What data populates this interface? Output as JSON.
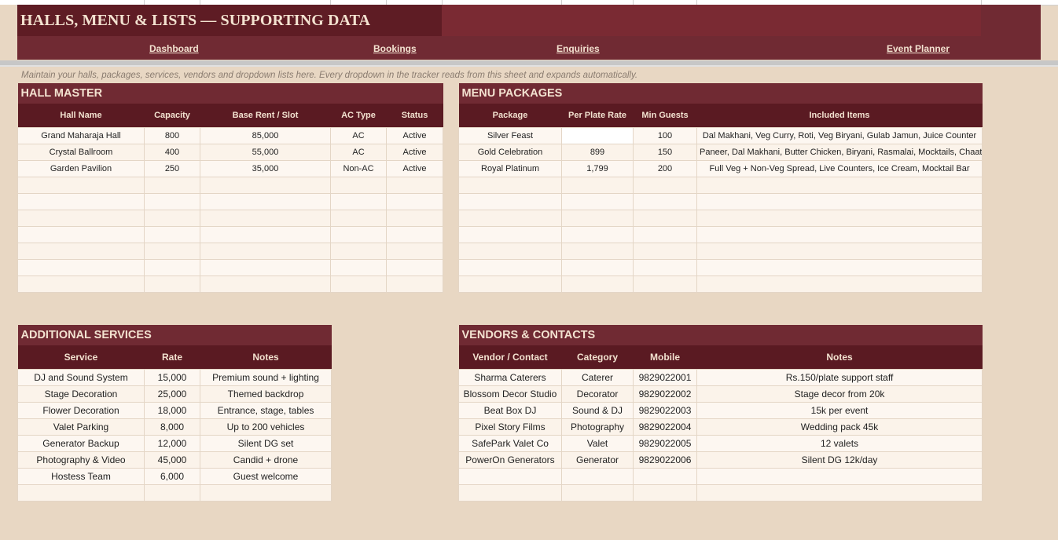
{
  "header": {
    "title": "HALLS, MENU & LISTS — SUPPORTING DATA",
    "nav": [
      "Dashboard",
      "Bookings",
      "Enquiries",
      "Event Planner"
    ]
  },
  "hint": "Maintain your halls, packages, services, vendors and dropdown lists here. Every dropdown in the tracker reads from this sheet and expands automatically.",
  "hall_master": {
    "title": "HALL MASTER",
    "columns": [
      "Hall Name",
      "Capacity",
      "Base Rent / Slot",
      "AC Type",
      "Status"
    ],
    "rows": [
      [
        "Grand Maharaja Hall",
        "800",
        "85,000",
        "AC",
        "Active"
      ],
      [
        "Crystal Ballroom",
        "400",
        "55,000",
        "AC",
        "Active"
      ],
      [
        "Garden Pavilion",
        "250",
        "35,000",
        "Non-AC",
        "Active"
      ],
      [
        "",
        "",
        "",
        "",
        ""
      ],
      [
        "",
        "",
        "",
        "",
        ""
      ],
      [
        "",
        "",
        "",
        "",
        ""
      ],
      [
        "",
        "",
        "",
        "",
        ""
      ],
      [
        "",
        "",
        "",
        "",
        ""
      ],
      [
        "",
        "",
        "",
        "",
        ""
      ],
      [
        "",
        "",
        "",
        "",
        ""
      ]
    ]
  },
  "menu_packages": {
    "title": "MENU PACKAGES",
    "columns": [
      "Package",
      "Per Plate Rate",
      "Min Guests",
      "Included Items"
    ],
    "rows": [
      [
        "Silver Feast",
        "",
        "100",
        "Dal Makhani, Veg Curry, Roti, Veg Biryani, Gulab Jamun, Juice Counter"
      ],
      [
        "Gold Celebration",
        "899",
        "150",
        "Paneer, Dal Makhani, Butter Chicken, Biryani, Rasmalai, Mocktails, Chaat"
      ],
      [
        "Royal Platinum",
        "1,799",
        "200",
        "Full Veg + Non-Veg Spread, Live Counters, Ice Cream, Mocktail Bar"
      ],
      [
        "",
        "",
        "",
        ""
      ],
      [
        "",
        "",
        "",
        ""
      ],
      [
        "",
        "",
        "",
        ""
      ],
      [
        "",
        "",
        "",
        ""
      ],
      [
        "",
        "",
        "",
        ""
      ],
      [
        "",
        "",
        "",
        ""
      ],
      [
        "",
        "",
        "",
        ""
      ]
    ]
  },
  "additional_services": {
    "title": "ADDITIONAL SERVICES",
    "columns": [
      "Service",
      "Rate",
      "Notes"
    ],
    "rows": [
      [
        "DJ and Sound System",
        "15,000",
        "Premium sound + lighting"
      ],
      [
        "Stage Decoration",
        "25,000",
        "Themed backdrop"
      ],
      [
        "Flower Decoration",
        "18,000",
        "Entrance, stage, tables"
      ],
      [
        "Valet Parking",
        "8,000",
        "Up to 200 vehicles"
      ],
      [
        "Generator Backup",
        "12,000",
        "Silent DG set"
      ],
      [
        "Photography & Video",
        "45,000",
        "Candid + drone"
      ],
      [
        "Hostess Team",
        "6,000",
        "Guest welcome"
      ],
      [
        "",
        "",
        ""
      ]
    ]
  },
  "vendors_contacts": {
    "title": "VENDORS & CONTACTS",
    "columns": [
      "Vendor / Contact",
      "Category",
      "Mobile",
      "Notes"
    ],
    "rows": [
      [
        "Sharma Caterers",
        "Caterer",
        "9829022001",
        "Rs.150/plate support staff"
      ],
      [
        "Blossom Decor Studio",
        "Decorator",
        "9829022002",
        "Stage decor from 20k"
      ],
      [
        "Beat Box DJ",
        "Sound & DJ",
        "9829022003",
        "15k per event"
      ],
      [
        "Pixel Story Films",
        "Photography",
        "9829022004",
        "Wedding pack 45k"
      ],
      [
        "SafePark Valet Co",
        "Valet",
        "9829022005",
        "12 valets"
      ],
      [
        "PowerOn Generators",
        "Generator",
        "9829022006",
        "Silent DG 12k/day"
      ],
      [
        "",
        "",
        "",
        ""
      ],
      [
        "",
        "",
        "",
        ""
      ]
    ]
  }
}
